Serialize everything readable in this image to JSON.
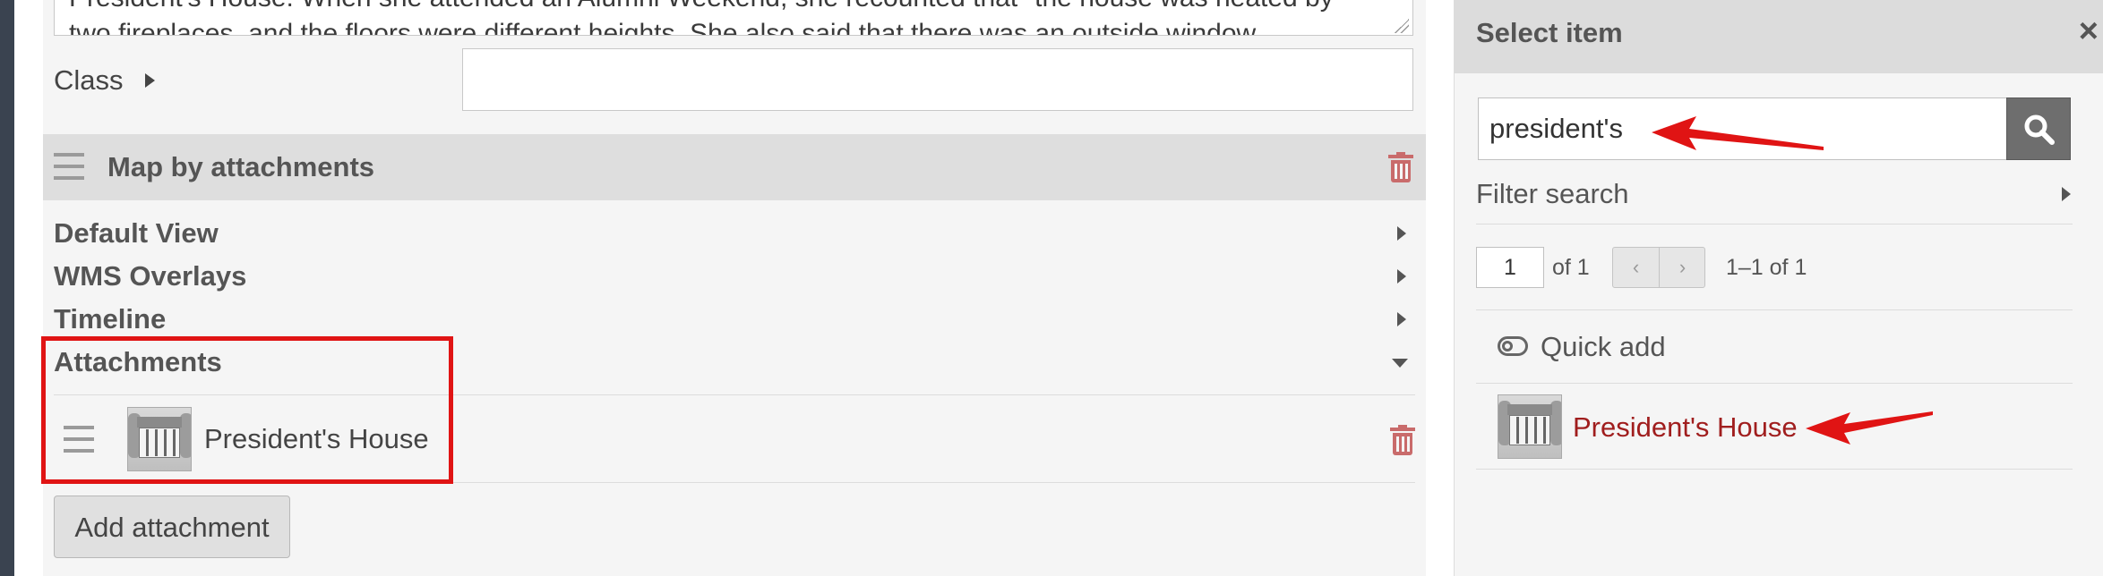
{
  "form": {
    "description_line1": "President's House. When she attended an Alumni Weekend, she recounted that \"the house was heated by",
    "description_line2": "two fireplaces, and the floors were different heights. She also said that there was an outside window",
    "class_label": "Class"
  },
  "block": {
    "title": "Map by attachments",
    "sections": [
      {
        "label": "Default View"
      },
      {
        "label": "WMS Overlays"
      },
      {
        "label": "Timeline"
      },
      {
        "label": "Attachments"
      }
    ],
    "attachments": [
      {
        "title": "President's House"
      }
    ],
    "add_attachment_label": "Add attachment"
  },
  "panel": {
    "title": "Select item",
    "close_glyph": "×",
    "search_value": "president's",
    "filter_label": "Filter search",
    "page_value": "1",
    "page_of": "of 1",
    "prev_glyph": "‹",
    "next_glyph": "›",
    "range_text": "1–1 of 1",
    "quick_add_label": "Quick add",
    "results": [
      {
        "title": "President's House"
      }
    ]
  },
  "colors": {
    "accent_red": "#e01414",
    "link_red": "#a01e1e",
    "trash_red": "#c96b6b"
  },
  "icons": [
    "drag-handle-icon",
    "trash-icon",
    "caret-right-icon",
    "caret-down-icon",
    "search-icon",
    "close-icon",
    "toggle-icon",
    "thumbnail-image"
  ]
}
